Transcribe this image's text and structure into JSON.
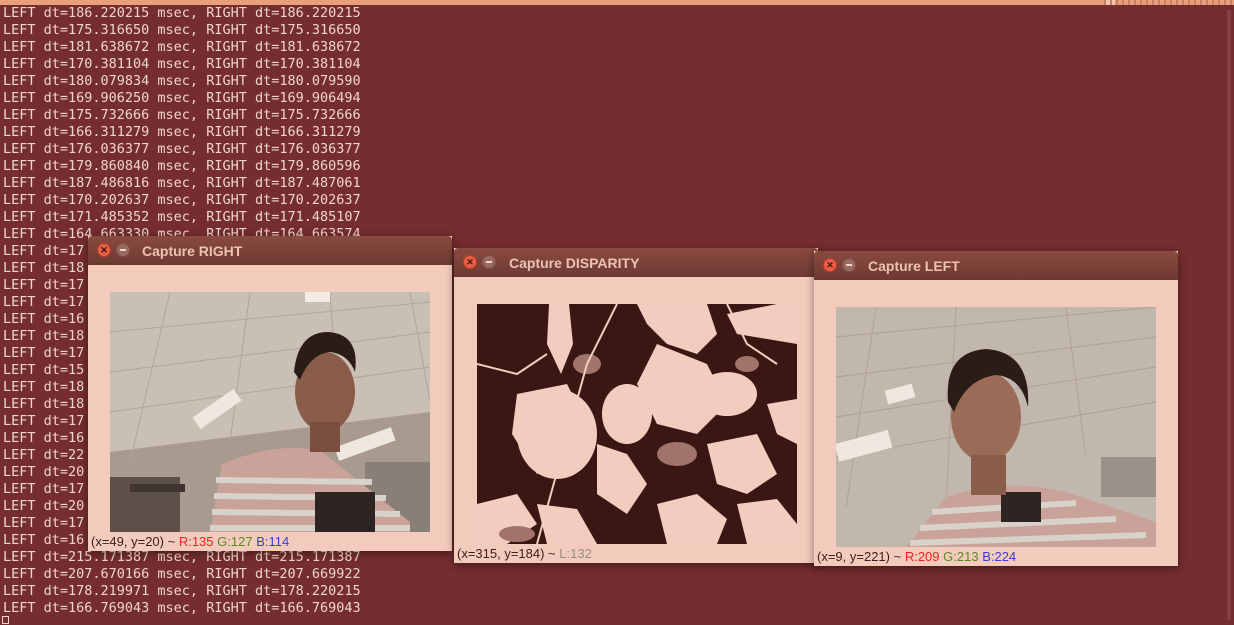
{
  "terminal": {
    "lines": [
      "LEFT dt=186.220215 msec, RIGHT dt=186.220215",
      "LEFT dt=175.316650 msec, RIGHT dt=175.316650",
      "LEFT dt=181.638672 msec, RIGHT dt=181.638672",
      "LEFT dt=170.381104 msec, RIGHT dt=170.381104",
      "LEFT dt=180.079834 msec, RIGHT dt=180.079590",
      "LEFT dt=169.906250 msec, RIGHT dt=169.906494",
      "LEFT dt=175.732666 msec, RIGHT dt=175.732666",
      "LEFT dt=166.311279 msec, RIGHT dt=166.311279",
      "LEFT dt=176.036377 msec, RIGHT dt=176.036377",
      "LEFT dt=179.860840 msec, RIGHT dt=179.860596",
      "LEFT dt=187.486816 msec, RIGHT dt=187.487061",
      "LEFT dt=170.202637 msec, RIGHT dt=170.202637",
      "LEFT dt=171.485352 msec, RIGHT dt=171.485107",
      "LEFT dt=164.663330 msec, RIGHT dt=164.663574",
      "LEFT dt=17",
      "LEFT dt=18",
      "LEFT dt=17",
      "LEFT dt=17",
      "LEFT dt=16",
      "LEFT dt=18",
      "LEFT dt=17",
      "LEFT dt=15",
      "LEFT dt=18",
      "LEFT dt=18",
      "LEFT dt=17",
      "LEFT dt=16",
      "LEFT dt=22",
      "LEFT dt=20",
      "LEFT dt=17",
      "LEFT dt=20",
      "LEFT dt=17",
      "LEFT dt=16",
      "LEFT dt=215.171387 msec, RIGHT dt=215.171387",
      "LEFT dt=207.670166 msec, RIGHT dt=207.669922",
      "LEFT dt=178.219971 msec, RIGHT dt=178.220215",
      "LEFT dt=166.769043 msec, RIGHT dt=166.769043"
    ]
  },
  "windows": {
    "right": {
      "title": "Capture RIGHT",
      "status_coord": "(x=49, y=20) ~ ",
      "r": "R:135",
      "g": "G:127",
      "b": "B:114"
    },
    "disparity": {
      "title": "Capture DISPARITY",
      "status_coord": "(x=315, y=184) ~ ",
      "l": "L:132"
    },
    "left": {
      "title": "Capture LEFT",
      "status_coord": "(x=9, y=221) ~ ",
      "r": "R:209",
      "g": "G:213",
      "b": "B:224"
    }
  },
  "icons": {
    "close": "close-icon",
    "minimize": "minimize-icon"
  },
  "colors": {
    "terminal_bg": "#752d2f",
    "terminal_text": "#efd6cd",
    "window_bg": "#f3cbbc",
    "titlebar": "#6c3a32"
  }
}
